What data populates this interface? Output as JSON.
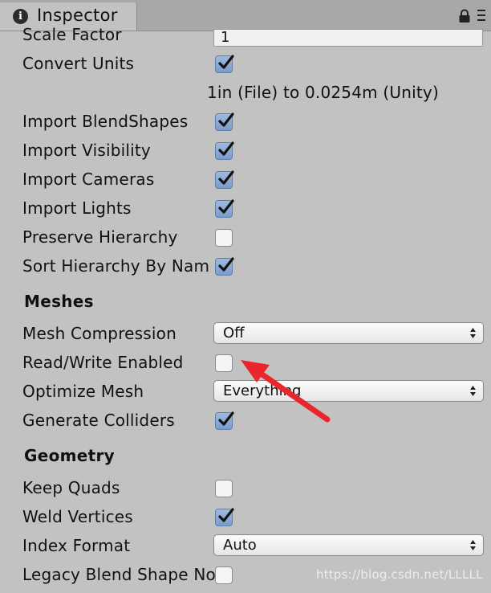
{
  "tab": {
    "title": "Inspector",
    "icon": "info-icon",
    "info_glyph": "i"
  },
  "toolbar": {
    "lock_icon": "lock-icon",
    "menu_icon": "context-menu-icon"
  },
  "scale_factor": {
    "label": "Scale Factor",
    "value": "1"
  },
  "convert_units": {
    "label": "Convert Units",
    "checked": true,
    "note": "1in (File) to 0.0254m (Unity)"
  },
  "rows_top": [
    {
      "label": "Import BlendShapes",
      "checked": true
    },
    {
      "label": "Import Visibility",
      "checked": true
    },
    {
      "label": "Import Cameras",
      "checked": true
    },
    {
      "label": "Import Lights",
      "checked": true
    },
    {
      "label": "Preserve Hierarchy",
      "checked": false
    },
    {
      "label": "Sort Hierarchy By Nam",
      "checked": true
    }
  ],
  "meshes": {
    "header": "Meshes",
    "mesh_compression": {
      "label": "Mesh Compression",
      "value": "Off"
    },
    "read_write": {
      "label": "Read/Write Enabled",
      "checked": false
    },
    "optimize_mesh": {
      "label": "Optimize Mesh",
      "value": "Everything"
    },
    "generate_colliders": {
      "label": "Generate Colliders",
      "checked": true
    }
  },
  "geometry": {
    "header": "Geometry",
    "keep_quads": {
      "label": "Keep Quads",
      "checked": false
    },
    "weld_vertices": {
      "label": "Weld Vertices",
      "checked": true
    },
    "index_format": {
      "label": "Index Format",
      "value": "Auto"
    },
    "legacy_blend": {
      "label": "Legacy Blend Shape No",
      "checked": false
    }
  },
  "annotation": {
    "color": "#e8262c"
  },
  "watermark": "https://blog.csdn.net/LLLLL"
}
